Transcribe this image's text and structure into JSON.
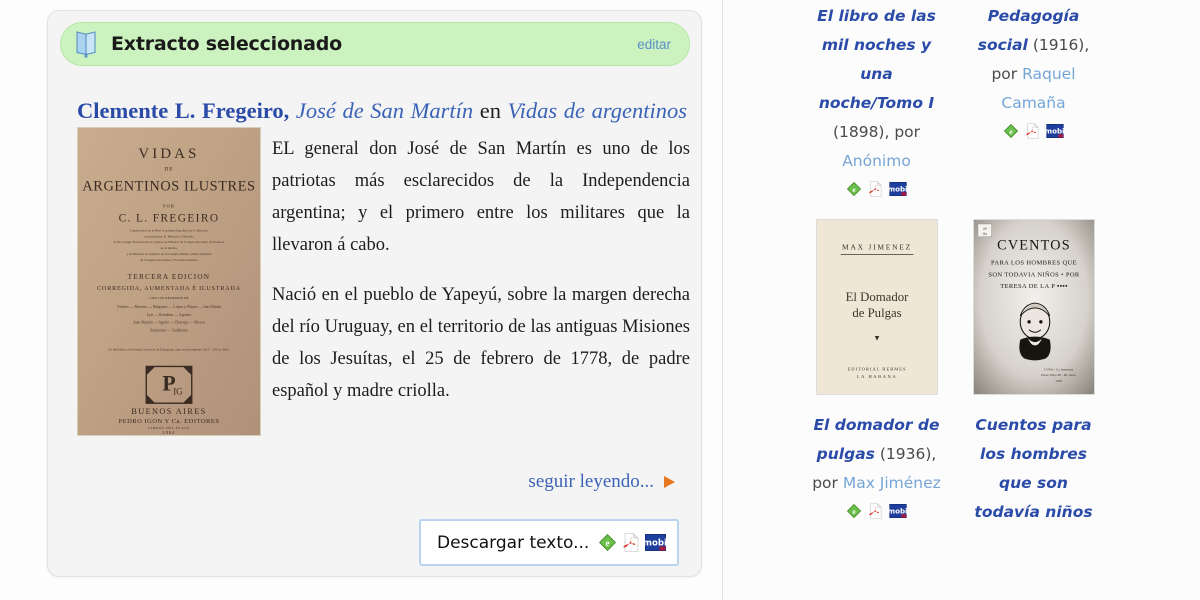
{
  "card": {
    "header_title": "Extracto seleccionado",
    "edit_label": "editar",
    "book_icon": "book-icon"
  },
  "work": {
    "author": "Clemente L. Fregeiro",
    "comma": ",",
    "piece": "José de San Martín",
    "connector": "en",
    "book": "Vidas de argentinos ilustres",
    "year": "1894",
    "cover_alt": "VIDAS DE ARGENTINOS ILUSTRES"
  },
  "excerpt": {
    "paragraphs": [
      "EL general don José de San Martín es uno de los patriotas más esclarecidos de la Independencia argentina; y el primero entre los militares que la llevaron á cabo.",
      "Nació en el pueblo de Yapeyú, sobre la margen derecha del río Uruguay, en el territorio de las antiguas Misiones de los Jesuítas, el 25 de febrero de 1778, de padre español y madre criolla."
    ],
    "continue_label": "seguir leyendo...",
    "continue_icon": "triangle-right-icon"
  },
  "download": {
    "label": "Descargar texto...",
    "formats": [
      "epub-icon",
      "pdf-icon",
      "mobi-icon"
    ]
  },
  "sidebar": {
    "rows": [
      {
        "items": [
          {
            "title": "El libro de las mil noches y una noche/Tomo I",
            "year": "(1898),",
            "por": "por",
            "author": "Anónimo",
            "formats": [
              "epub-icon",
              "pdf-icon",
              "mobi-icon"
            ],
            "has_cover": false
          },
          {
            "title": "Pedagogía social",
            "year": "(1916),",
            "por": "por",
            "author": "Raquel Camaña",
            "formats": [
              "epub-icon",
              "pdf-icon",
              "mobi-icon"
            ],
            "has_cover": false
          }
        ]
      },
      {
        "items": [
          {
            "title": "El domador de pulgas",
            "year": "(1936),",
            "por": "por",
            "author": "Max Jiménez",
            "formats": [
              "epub-icon",
              "pdf-icon",
              "mobi-icon"
            ],
            "has_cover": true,
            "cover_alt": "MAX JIMENEZ El Domador de Pulgas"
          },
          {
            "title": "Cuentos para los hombres que son todavía niños",
            "year": "",
            "por": "",
            "author": "",
            "formats": [],
            "has_cover": true,
            "cover_alt": "CVENTOS PARA LOS HOMBRES QUE SON TODAVIA NIÑOS"
          }
        ]
      }
    ]
  },
  "colors": {
    "header_green": "#ccf3bf",
    "title_blue": "#2b4ba8",
    "link_blue": "#3a63b8",
    "author_link_blue": "#76a6d8",
    "edit_blue": "#5b8fc9",
    "card_bg": "#f4f4f4",
    "download_border": "#b8d4ef",
    "epub_green": "#57b03a",
    "pdf_red": "#d93b2b",
    "mobi_blue": "#1f3f9e",
    "arrow_orange": "#e87722"
  }
}
